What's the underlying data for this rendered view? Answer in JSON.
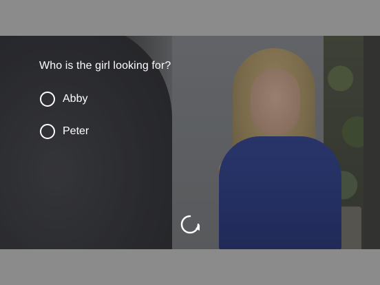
{
  "quiz": {
    "question": "Who is the girl looking for?",
    "options": [
      {
        "label": "Abby",
        "selected": false
      },
      {
        "label": "Peter",
        "selected": false
      }
    ]
  },
  "controls": {
    "replay_icon": "replay-icon"
  },
  "colors": {
    "letterbox": "#8b8b8b",
    "text": "#ffffff",
    "shirt": "#27367a"
  }
}
